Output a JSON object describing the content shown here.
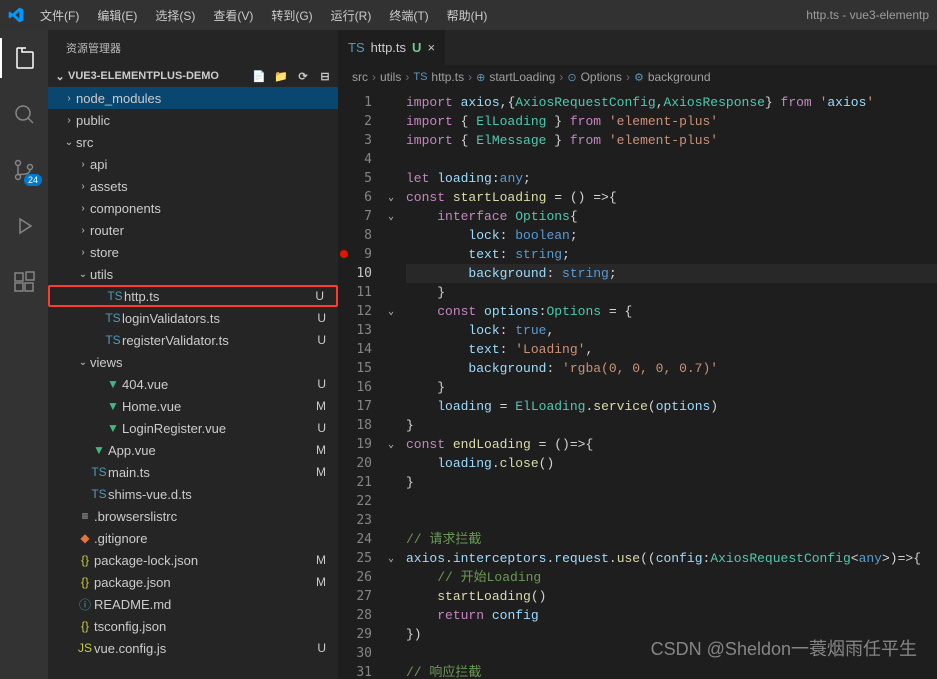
{
  "titlebar": {
    "menus": [
      "文件(F)",
      "编辑(E)",
      "选择(S)",
      "查看(V)",
      "转到(G)",
      "运行(R)",
      "终端(T)",
      "帮助(H)"
    ],
    "windowTitle": "http.ts - vue3-elementp"
  },
  "activitybar": {
    "source_control_badge": "24"
  },
  "sidebar": {
    "title": "资源管理器",
    "project": "VUE3-ELEMENTPLUS-DEMO",
    "tree": [
      {
        "type": "folder",
        "open": false,
        "depth": 1,
        "name": "node_modules",
        "selected": true
      },
      {
        "type": "folder",
        "open": false,
        "depth": 1,
        "name": "public"
      },
      {
        "type": "folder",
        "open": true,
        "depth": 1,
        "name": "src"
      },
      {
        "type": "folder",
        "open": false,
        "depth": 2,
        "name": "api"
      },
      {
        "type": "folder",
        "open": false,
        "depth": 2,
        "name": "assets"
      },
      {
        "type": "folder",
        "open": false,
        "depth": 2,
        "name": "components"
      },
      {
        "type": "folder",
        "open": false,
        "depth": 2,
        "name": "router"
      },
      {
        "type": "folder",
        "open": false,
        "depth": 2,
        "name": "store"
      },
      {
        "type": "folder",
        "open": true,
        "depth": 2,
        "name": "utils"
      },
      {
        "type": "file",
        "depth": 3,
        "name": "http.ts",
        "icon": "ts",
        "git": "U",
        "highlight": true
      },
      {
        "type": "file",
        "depth": 3,
        "name": "loginValidators.ts",
        "icon": "ts",
        "git": "U"
      },
      {
        "type": "file",
        "depth": 3,
        "name": "registerValidator.ts",
        "icon": "ts",
        "git": "U"
      },
      {
        "type": "folder",
        "open": true,
        "depth": 2,
        "name": "views"
      },
      {
        "type": "file",
        "depth": 3,
        "name": "404.vue",
        "icon": "vue",
        "git": "U"
      },
      {
        "type": "file",
        "depth": 3,
        "name": "Home.vue",
        "icon": "vue",
        "git": "M"
      },
      {
        "type": "file",
        "depth": 3,
        "name": "LoginRegister.vue",
        "icon": "vue",
        "git": "U"
      },
      {
        "type": "file",
        "depth": 2,
        "name": "App.vue",
        "icon": "vue",
        "git": "M"
      },
      {
        "type": "file",
        "depth": 2,
        "name": "main.ts",
        "icon": "ts",
        "git": "M"
      },
      {
        "type": "file",
        "depth": 2,
        "name": "shims-vue.d.ts",
        "icon": "ts"
      },
      {
        "type": "file",
        "depth": 1,
        "name": ".browserslistrc",
        "icon": "list"
      },
      {
        "type": "file",
        "depth": 1,
        "name": ".gitignore",
        "icon": "git"
      },
      {
        "type": "file",
        "depth": 1,
        "name": "package-lock.json",
        "icon": "json",
        "git": "M"
      },
      {
        "type": "file",
        "depth": 1,
        "name": "package.json",
        "icon": "json",
        "git": "M"
      },
      {
        "type": "file",
        "depth": 1,
        "name": "README.md",
        "icon": "info"
      },
      {
        "type": "file",
        "depth": 1,
        "name": "tsconfig.json",
        "icon": "json"
      },
      {
        "type": "file",
        "depth": 1,
        "name": "vue.config.js",
        "icon": "js",
        "git": "U"
      }
    ]
  },
  "tabs": [
    {
      "icon": "ts",
      "label": "http.ts",
      "modified": "U"
    }
  ],
  "breadcrumbs": [
    "src",
    "utils",
    "http.ts",
    "startLoading",
    "Options",
    "background"
  ],
  "code": {
    "lines": [
      "import axios,{AxiosRequestConfig,AxiosResponse} from 'axios'",
      "import { ElLoading } from 'element-plus'",
      "import { ElMessage } from 'element-plus'",
      "",
      "let loading:any;",
      "const startLoading = () =>{",
      "    interface Options{",
      "        lock: boolean;",
      "        text: string;",
      "        background: string;",
      "    }",
      "    const options:Options = {",
      "        lock: true,",
      "        text: 'Loading',",
      "        background: 'rgba(0, 0, 0, 0.7)'",
      "    }",
      "    loading = ElLoading.service(options)",
      "}",
      "const endLoading = ()=>{",
      "    loading.close()",
      "}",
      "",
      "",
      "// 请求拦截",
      "axios.interceptors.request.use((config:AxiosRequestConfig<any>)=>{",
      "    // 开始Loading",
      "    startLoading()",
      "    return config",
      "})",
      "",
      "// 响应拦截"
    ],
    "currentLine": 10,
    "breakpointLine": 9,
    "folds": {
      "6": true,
      "7": true,
      "12": true,
      "19": true,
      "25": true
    }
  },
  "watermark": "CSDN @Sheldon一蓑烟雨任平生"
}
